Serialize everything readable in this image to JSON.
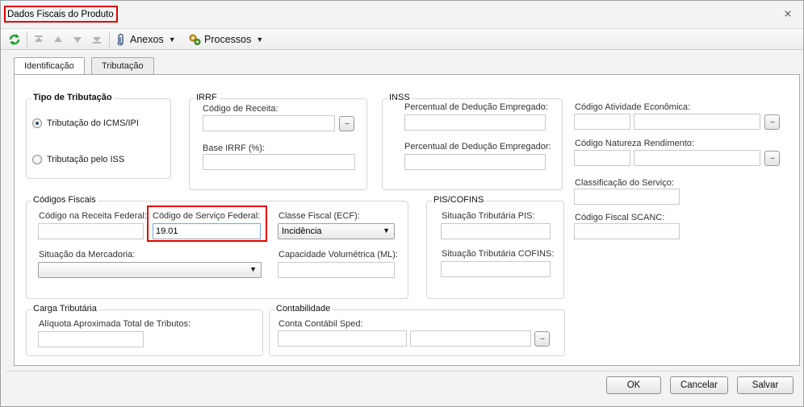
{
  "window": {
    "title": "Dados Fiscais do Produto",
    "close_glyph": "⨯"
  },
  "toolbar": {
    "anexos_label": "Anexos",
    "processos_label": "Processos",
    "caret": "▼"
  },
  "tabs": [
    {
      "label": "Identificação",
      "active": true
    },
    {
      "label": "Tributação",
      "active": false
    }
  ],
  "tipo_tributacao": {
    "title": "Tipo de Tributação",
    "options": [
      {
        "label": "Tributação do ICMS/IPI",
        "checked": true
      },
      {
        "label": "Tributação pelo ISS",
        "checked": false
      }
    ]
  },
  "irrf": {
    "title": "IRRF",
    "codigo_receita_label": "Código de Receita:",
    "codigo_receita_value": "",
    "base_label": "Base IRRF (%):",
    "base_value": ""
  },
  "inss": {
    "title": "INSS",
    "empregado_label": "Percentual de Dedução Empregado:",
    "empregado_value": "",
    "empregador_label": "Percentual de Dedução Empregador:",
    "empregador_value": ""
  },
  "right_fields": {
    "atividade_label": "Código Atividade Econômica:",
    "natureza_label": "Código Natureza Rendimento:",
    "classificacao_label": "Classificação do Serviço:",
    "scanc_label": "Código Fiscal SCANC:"
  },
  "codigos_fiscais": {
    "title": "Códigos Fiscais",
    "receita_federal_label": "Código na Receita Federal:",
    "servico_federal_label": "Código de Serviço Federal:",
    "servico_federal_value": "19.01",
    "classe_fiscal_label": "Classe Fiscal (ECF):",
    "classe_fiscal_value": "Incidência",
    "situacao_mercadoria_label": "Situação da Mercadoria:",
    "situacao_mercadoria_value": "",
    "capacidade_label": "Capacidade Volumétrica (ML):",
    "capacidade_value": ""
  },
  "pis_cofins": {
    "title": "PIS/COFINS",
    "pis_label": "Situação Tributária PIS:",
    "cofins_label": "Situação Tributária COFINS:"
  },
  "carga_tributaria": {
    "title": "Carga Tributária",
    "aliquota_label": "Alíquota Aproximada Total de Tributos:"
  },
  "contabilidade": {
    "title": "Contabilidade",
    "conta_label": "Conta Contábil Sped:"
  },
  "lookup_glyph": "...",
  "buttons": {
    "ok": "OK",
    "cancelar": "Cancelar",
    "salvar": "Salvar"
  },
  "colors": {
    "highlight": "#e00000",
    "refresh_icon": "#1f9e2d"
  }
}
